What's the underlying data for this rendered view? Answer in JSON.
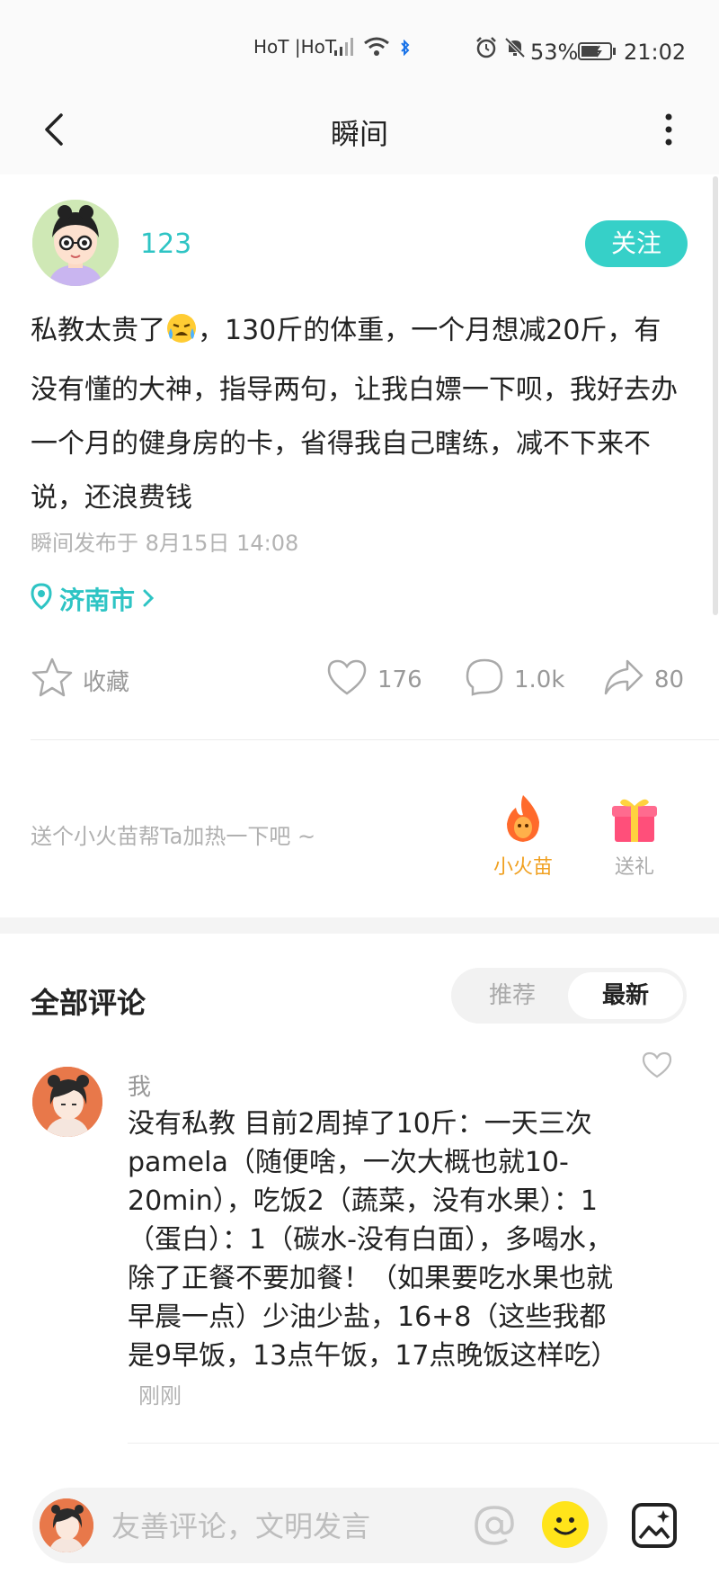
{
  "status_bar": {
    "carrier": "HoT |HoT",
    "battery": "53%",
    "time": "21:02"
  },
  "header": {
    "title": "瞬间"
  },
  "post": {
    "username": "123",
    "follow_label": "关注",
    "text_before_emoji": "私教太贵了",
    "text_after_emoji": "，130斤的体重，一个月想减20斤，有没有懂的大神，指导两句，让我白嫖一下呗，我好去办一个月的健身房的卡，省得我自己瞎练，减不下来不说，还浪费钱",
    "published": "瞬间发布于 8月15日 14:08",
    "location": "济南市"
  },
  "actions": {
    "favorite_label": "收藏",
    "likes": "176",
    "comments": "1.0k",
    "shares": "80"
  },
  "gift_section": {
    "hint": "送个小火苗帮Ta加热一下吧 ~",
    "fire_label": "小火苗",
    "gift_label": "送礼"
  },
  "comments_section": {
    "title": "全部评论",
    "tabs": [
      "推荐",
      "最新"
    ],
    "active_tab": "最新",
    "items": [
      {
        "user": "我",
        "text": "没有私教 目前2周掉了10斤：一天三次pamela（随便啥，一次大概也就10-20min），吃饭2（蔬菜，没有水果）：1（蛋白）：1（碳水-没有白面），多喝水，除了正餐不要加餐！（如果要吃水果也就早晨一点）少油少盐，16+8（这些我都是9早饭，13点午饭，17点晚饭这样吃）",
        "time": "刚刚"
      }
    ]
  },
  "comment_input": {
    "placeholder": "友善评论，文明发言"
  },
  "colors": {
    "accent": "#36d0c8",
    "fire": "#ff6a2b",
    "gift": "#ff4f7a"
  }
}
